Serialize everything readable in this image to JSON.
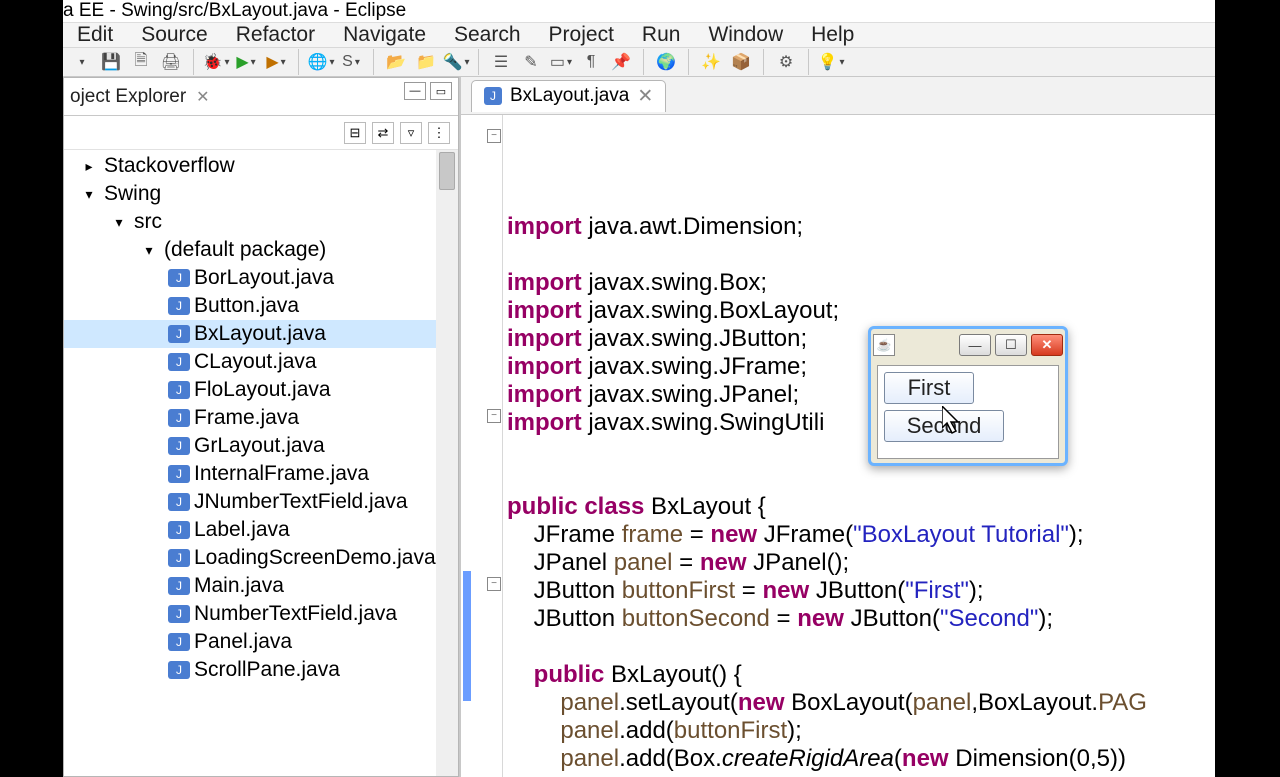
{
  "titlebar": "a EE - Swing/src/BxLayout.java - Eclipse",
  "menubar": [
    "Edit",
    "Source",
    "Refactor",
    "Navigate",
    "Search",
    "Project",
    "Run",
    "Window",
    "Help"
  ],
  "explorer": {
    "title": "oject Explorer",
    "items": [
      {
        "indent": 14,
        "icon": "▸",
        "name": "Stackoverflow"
      },
      {
        "indent": 14,
        "icon": "▾",
        "name": "Swing"
      },
      {
        "indent": 44,
        "icon": "▾",
        "name": "src"
      },
      {
        "indent": 74,
        "icon": "▾",
        "name": "(default package)"
      },
      {
        "indent": 104,
        "icon": "J",
        "name": "BorLayout.java"
      },
      {
        "indent": 104,
        "icon": "J",
        "name": "Button.java"
      },
      {
        "indent": 104,
        "icon": "J",
        "name": "BxLayout.java",
        "selected": true
      },
      {
        "indent": 104,
        "icon": "J",
        "name": "CLayout.java"
      },
      {
        "indent": 104,
        "icon": "J",
        "name": "FloLayout.java"
      },
      {
        "indent": 104,
        "icon": "J",
        "name": "Frame.java"
      },
      {
        "indent": 104,
        "icon": "J",
        "name": "GrLayout.java"
      },
      {
        "indent": 104,
        "icon": "J",
        "name": "InternalFrame.java"
      },
      {
        "indent": 104,
        "icon": "J",
        "name": "JNumberTextField.java"
      },
      {
        "indent": 104,
        "icon": "J",
        "name": "Label.java"
      },
      {
        "indent": 104,
        "icon": "J",
        "name": "LoadingScreenDemo.java"
      },
      {
        "indent": 104,
        "icon": "J",
        "name": "Main.java"
      },
      {
        "indent": 104,
        "icon": "J",
        "name": "NumberTextField.java"
      },
      {
        "indent": 104,
        "icon": "J",
        "name": "Panel.java"
      },
      {
        "indent": 104,
        "icon": "J",
        "name": "ScrollPane.java"
      }
    ]
  },
  "editor": {
    "tab": "BxLayout.java",
    "code_lines": [
      {
        "t": "import",
        "r": " java.awt.Dimension;"
      },
      {
        "blank": true
      },
      {
        "t": "import",
        "r": " javax.swing.Box;"
      },
      {
        "t": "import",
        "r": " javax.swing.BoxLayout;"
      },
      {
        "t": "import",
        "r": " javax.swing.JButton;"
      },
      {
        "t": "import",
        "r": " javax.swing.JFrame;"
      },
      {
        "t": "import",
        "r": " javax.swing.JPanel;"
      },
      {
        "t": "import",
        "r": " javax.swing.SwingUtili"
      },
      {
        "blank": true
      },
      {
        "blank": true
      },
      {
        "html": "<span class='kw'>public class</span> BxLayout {"
      },
      {
        "html": "    JFrame <span class='var'>frame</span> = <span class='kw'>new</span> JFrame(<span class='str'>\"BoxLayout Tutorial\"</span>);"
      },
      {
        "html": "    JPanel <span class='var'>panel</span> = <span class='kw'>new</span> JPanel();"
      },
      {
        "html": "    JButton <span class='var'>buttonFirst</span> = <span class='kw'>new</span> JButton(<span class='str'>\"First\"</span>);"
      },
      {
        "html": "    JButton <span class='var'>buttonSecond</span> = <span class='kw'>new</span> JButton(<span class='str'>\"Second\"</span>);"
      },
      {
        "blank": true
      },
      {
        "html": "    <span class='kw'>public</span> BxLayout() {"
      },
      {
        "html": "        <span class='var'>panel</span>.setLayout(<span class='kw'>new</span> BoxLayout(<span class='var'>panel</span>,BoxLayout.<span class='var'>PAG</span>"
      },
      {
        "html": "        <span class='var'>panel</span>.add(<span class='var'>buttonFirst</span>);"
      },
      {
        "html": "        <span class='var'>panel</span>.add(Box.<span class='mtd'>createRigidArea</span>(<span class='kw'>new</span> Dimension(0,5))"
      }
    ]
  },
  "swing": {
    "first": "First",
    "second": "Second"
  }
}
